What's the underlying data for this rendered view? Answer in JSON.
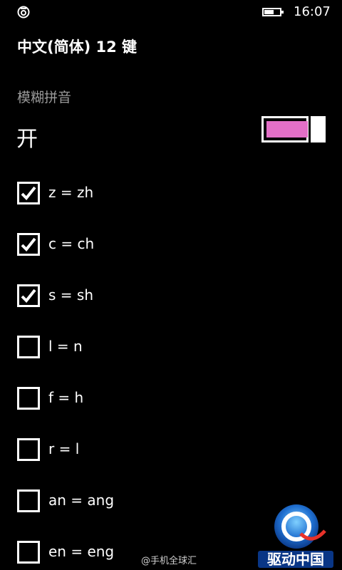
{
  "status": {
    "time": "16:07",
    "battery_level": 0.6,
    "left_icon": "notification-icon"
  },
  "header": {
    "title": "中文(简体) 12 键"
  },
  "fuzzy_pinyin": {
    "label": "模糊拼音",
    "state_text": "开",
    "toggle_on": true,
    "accent_color": "#e36fc7"
  },
  "options": [
    {
      "label": "z = zh",
      "checked": true
    },
    {
      "label": "c = ch",
      "checked": true
    },
    {
      "label": "s = sh",
      "checked": true
    },
    {
      "label": "l = n",
      "checked": false
    },
    {
      "label": "f = h",
      "checked": false
    },
    {
      "label": "r = l",
      "checked": false
    },
    {
      "label": "an = ang",
      "checked": false
    },
    {
      "label": "en = eng",
      "checked": false
    }
  ],
  "watermark": {
    "text": "@手机全球汇",
    "logo_text": "驱动中国"
  }
}
